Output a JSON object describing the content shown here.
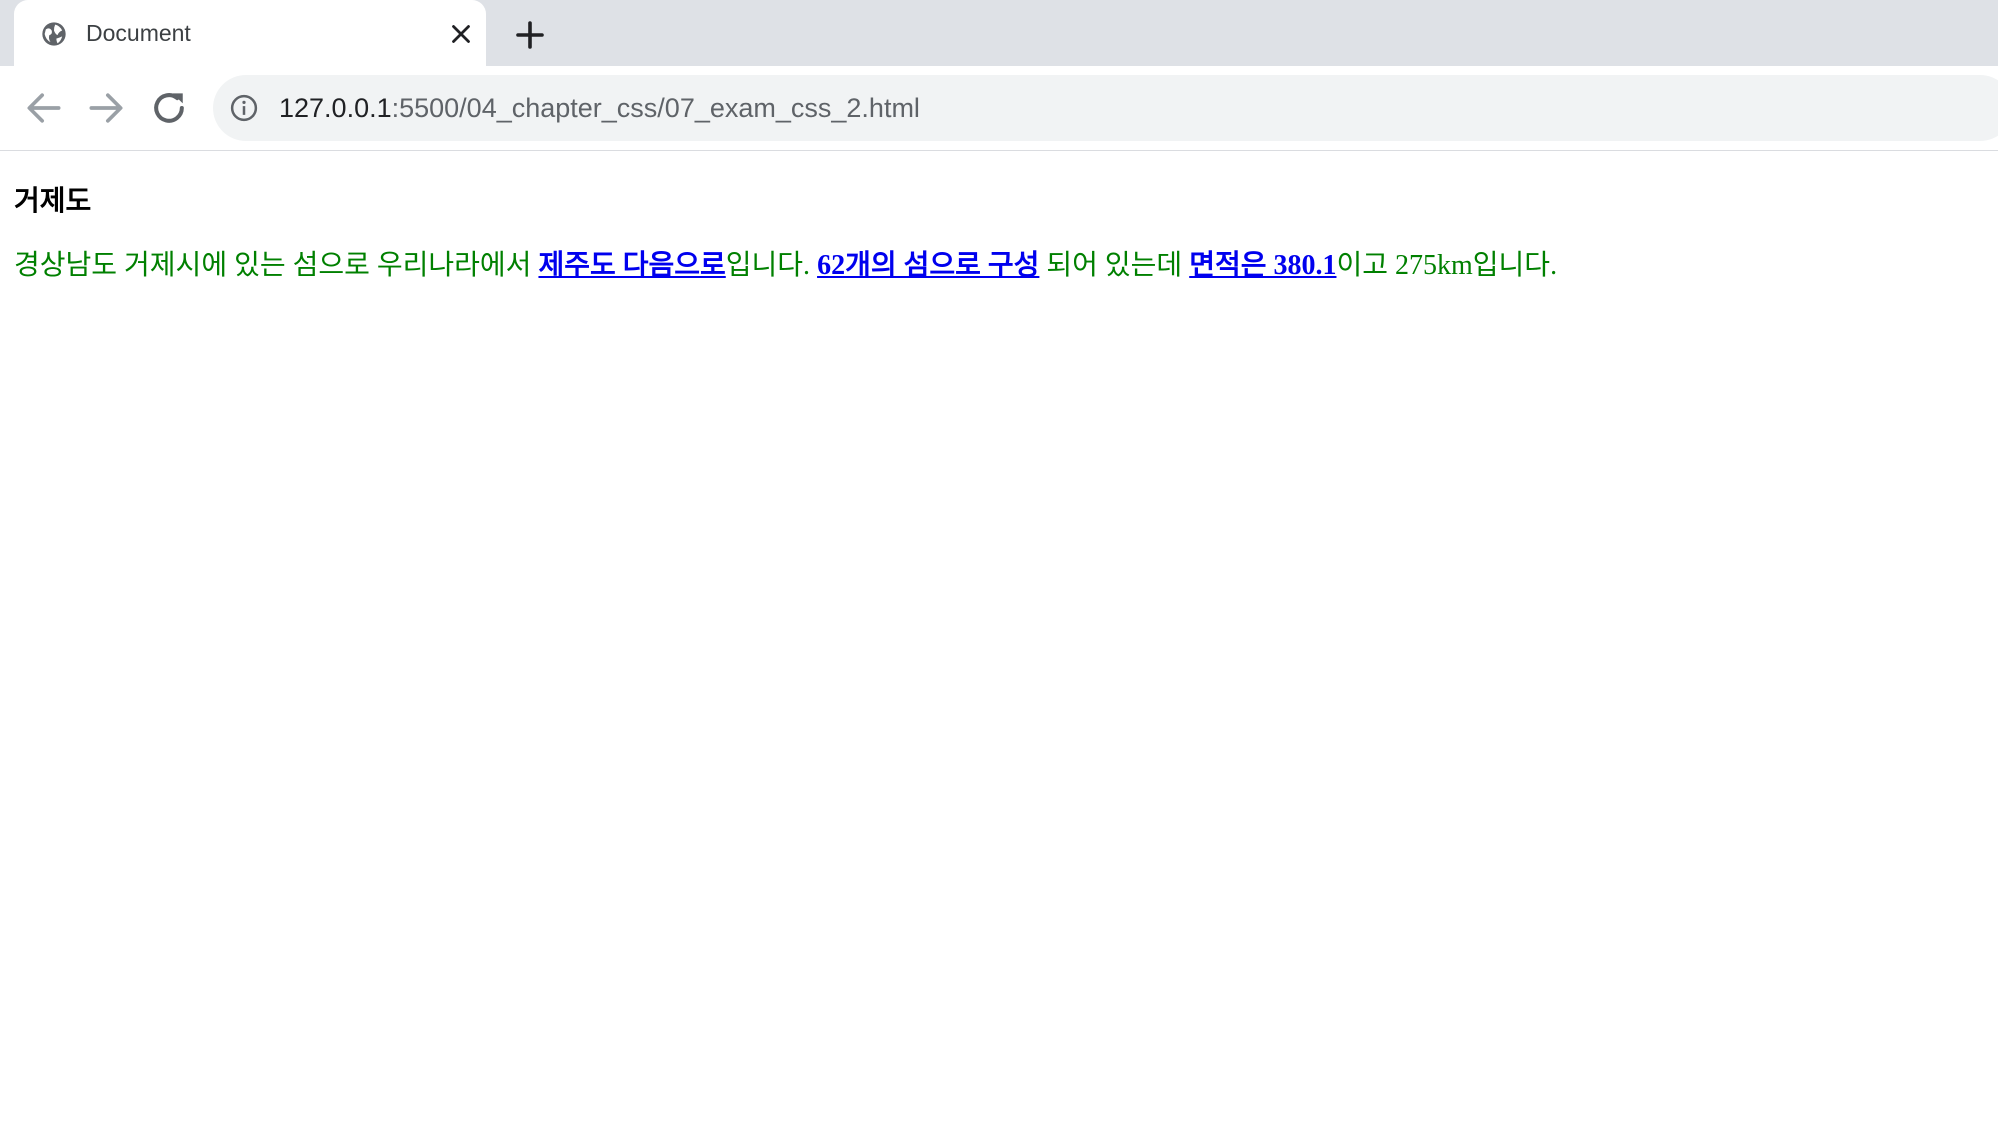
{
  "browser": {
    "tab": {
      "title": "Document",
      "favicon": "globe-icon",
      "close_icon": "close-icon"
    },
    "new_tab_icon": "plus-icon",
    "toolbar": {
      "back_icon": "arrow-left-icon",
      "forward_icon": "arrow-right-icon",
      "reload_icon": "reload-icon",
      "info_icon": "info-icon",
      "url_host": "127.0.0.1",
      "url_path": ":5500/04_chapter_css/07_exam_css_2.html"
    },
    "colors": {
      "tabstrip_bg": "#dee1e6",
      "omnibox_bg": "#f1f3f4",
      "text_green": "#008000",
      "link_blue": "#0000ee"
    }
  },
  "page": {
    "title": "거제도",
    "paragraph": {
      "text_1": "경상남도 거제시에 있는 섬으로 우리나라에서 ",
      "link_1": "제주도 다음으로",
      "text_2": "입니다. ",
      "link_2": "62개의 섬으로 구성",
      "text_3": " 되어 있는데 ",
      "link_3": "면적은 380.1",
      "text_4": "이고 275km입니다."
    }
  }
}
